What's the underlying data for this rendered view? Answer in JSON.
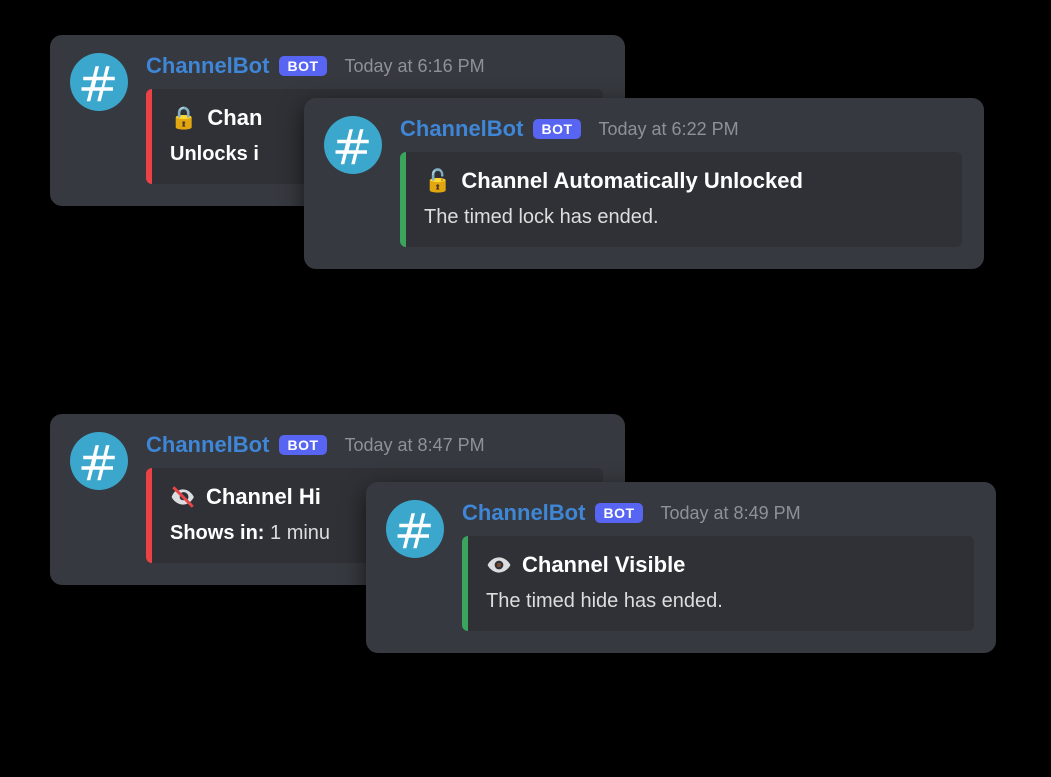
{
  "bot_tag": "BOT",
  "messages": [
    {
      "author": "ChannelBot",
      "timestamp": "Today at 6:16 PM",
      "embed": {
        "bar_color": "red",
        "icon": "lock-icon",
        "icon_glyph": "🔒",
        "title": "Chan",
        "desc_prefix_bold": "Unlocks i",
        "desc_rest": ""
      }
    },
    {
      "author": "ChannelBot",
      "timestamp": "Today at 6:22 PM",
      "embed": {
        "bar_color": "green",
        "icon": "unlock-icon",
        "icon_glyph": "🔓",
        "title": "Channel Automatically Unlocked",
        "desc_prefix_bold": "",
        "desc_rest": "The timed lock has ended."
      }
    },
    {
      "author": "ChannelBot",
      "timestamp": "Today at 8:47 PM",
      "embed": {
        "bar_color": "red",
        "icon": "eye-off-icon",
        "icon_glyph": "🙈",
        "title": "Channel Hi",
        "desc_prefix_bold": "Shows in:",
        "desc_rest": " 1 minu"
      }
    },
    {
      "author": "ChannelBot",
      "timestamp": "Today at 8:49 PM",
      "embed": {
        "bar_color": "green",
        "icon": "eye-icon",
        "icon_glyph": "👁️",
        "title": "Channel Visible",
        "desc_prefix_bold": "",
        "desc_rest": "The timed hide has ended."
      }
    }
  ]
}
